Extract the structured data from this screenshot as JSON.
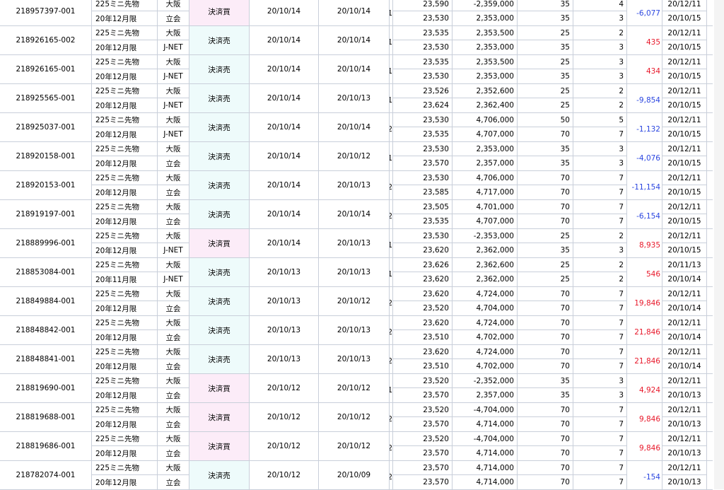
{
  "rows": [
    {
      "id": "218957397-001",
      "product": "225ミニ先物",
      "month": "20年12月限",
      "market1": "大阪",
      "market2": "立会",
      "action": "決済買",
      "date1": "20/10/14",
      "date2": "20/10/14",
      "qty": "1",
      "p1": "23,590",
      "a1": "-2,359,000",
      "f1": "35",
      "t1": "4",
      "p2": "23,530",
      "a2": "2,353,000",
      "f2": "35",
      "t2": "3",
      "pl": "-6,077",
      "sign": "neg",
      "d1": "20/12/11",
      "d2": "20/10/15"
    },
    {
      "id": "218926165-002",
      "product": "225ミニ先物",
      "month": "20年12月限",
      "market1": "大阪",
      "market2": "J-NET",
      "action": "決済売",
      "date1": "20/10/14",
      "date2": "20/10/14",
      "qty": "1",
      "p1": "23,535",
      "a1": "2,353,500",
      "f1": "25",
      "t1": "2",
      "p2": "23,530",
      "a2": "2,353,000",
      "f2": "35",
      "t2": "3",
      "pl": "435",
      "sign": "pos",
      "d1": "20/12/11",
      "d2": "20/10/15"
    },
    {
      "id": "218926165-001",
      "product": "225ミニ先物",
      "month": "20年12月限",
      "market1": "大阪",
      "market2": "J-NET",
      "action": "決済売",
      "date1": "20/10/14",
      "date2": "20/10/14",
      "qty": "1",
      "p1": "23,535",
      "a1": "2,353,500",
      "f1": "25",
      "t1": "3",
      "p2": "23,530",
      "a2": "2,353,000",
      "f2": "35",
      "t2": "3",
      "pl": "434",
      "sign": "pos",
      "d1": "20/12/11",
      "d2": "20/10/15"
    },
    {
      "id": "218925565-001",
      "product": "225ミニ先物",
      "month": "20年12月限",
      "market1": "大阪",
      "market2": "J-NET",
      "action": "決済売",
      "date1": "20/10/14",
      "date2": "20/10/13",
      "qty": "1",
      "p1": "23,526",
      "a1": "2,352,600",
      "f1": "25",
      "t1": "2",
      "p2": "23,624",
      "a2": "2,362,400",
      "f2": "25",
      "t2": "2",
      "pl": "-9,854",
      "sign": "neg",
      "d1": "20/12/11",
      "d2": "20/10/15"
    },
    {
      "id": "218925037-001",
      "product": "225ミニ先物",
      "month": "20年12月限",
      "market1": "大阪",
      "market2": "J-NET",
      "action": "決済売",
      "date1": "20/10/14",
      "date2": "20/10/14",
      "qty": "2",
      "p1": "23,530",
      "a1": "4,706,000",
      "f1": "50",
      "t1": "5",
      "p2": "23,535",
      "a2": "4,707,000",
      "f2": "70",
      "t2": "7",
      "pl": "-1,132",
      "sign": "neg",
      "d1": "20/12/11",
      "d2": "20/10/15"
    },
    {
      "id": "218920158-001",
      "product": "225ミニ先物",
      "month": "20年12月限",
      "market1": "大阪",
      "market2": "立会",
      "action": "決済売",
      "date1": "20/10/14",
      "date2": "20/10/12",
      "qty": "1",
      "p1": "23,530",
      "a1": "2,353,000",
      "f1": "35",
      "t1": "3",
      "p2": "23,570",
      "a2": "2,357,000",
      "f2": "35",
      "t2": "3",
      "pl": "-4,076",
      "sign": "neg",
      "d1": "20/12/11",
      "d2": "20/10/15"
    },
    {
      "id": "218920153-001",
      "product": "225ミニ先物",
      "month": "20年12月限",
      "market1": "大阪",
      "market2": "立会",
      "action": "決済売",
      "date1": "20/10/14",
      "date2": "20/10/13",
      "qty": "2",
      "p1": "23,530",
      "a1": "4,706,000",
      "f1": "70",
      "t1": "7",
      "p2": "23,585",
      "a2": "4,717,000",
      "f2": "70",
      "t2": "7",
      "pl": "-11,154",
      "sign": "neg",
      "d1": "20/12/11",
      "d2": "20/10/15"
    },
    {
      "id": "218919197-001",
      "product": "225ミニ先物",
      "month": "20年12月限",
      "market1": "大阪",
      "market2": "立会",
      "action": "決済売",
      "date1": "20/10/14",
      "date2": "20/10/14",
      "qty": "2",
      "p1": "23,505",
      "a1": "4,701,000",
      "f1": "70",
      "t1": "7",
      "p2": "23,535",
      "a2": "4,707,000",
      "f2": "70",
      "t2": "7",
      "pl": "-6,154",
      "sign": "neg",
      "d1": "20/12/11",
      "d2": "20/10/15"
    },
    {
      "id": "218889996-001",
      "product": "225ミニ先物",
      "month": "20年12月限",
      "market1": "大阪",
      "market2": "J-NET",
      "action": "決済買",
      "date1": "20/10/14",
      "date2": "20/10/13",
      "qty": "1",
      "p1": "23,530",
      "a1": "-2,353,000",
      "f1": "25",
      "t1": "2",
      "p2": "23,620",
      "a2": "2,362,000",
      "f2": "35",
      "t2": "3",
      "pl": "8,935",
      "sign": "pos",
      "d1": "20/12/11",
      "d2": "20/10/15"
    },
    {
      "id": "218853084-001",
      "product": "225ミニ先物",
      "month": "20年11月限",
      "market1": "大阪",
      "market2": "J-NET",
      "action": "決済売",
      "date1": "20/10/13",
      "date2": "20/10/13",
      "qty": "1",
      "p1": "23,626",
      "a1": "2,362,600",
      "f1": "25",
      "t1": "2",
      "p2": "23,620",
      "a2": "2,362,000",
      "f2": "25",
      "t2": "2",
      "pl": "546",
      "sign": "pos",
      "d1": "20/11/13",
      "d2": "20/10/14"
    },
    {
      "id": "218849884-001",
      "product": "225ミニ先物",
      "month": "20年12月限",
      "market1": "大阪",
      "market2": "立会",
      "action": "決済売",
      "date1": "20/10/13",
      "date2": "20/10/12",
      "qty": "2",
      "p1": "23,620",
      "a1": "4,724,000",
      "f1": "70",
      "t1": "7",
      "p2": "23,520",
      "a2": "4,704,000",
      "f2": "70",
      "t2": "7",
      "pl": "19,846",
      "sign": "pos",
      "d1": "20/12/11",
      "d2": "20/10/14"
    },
    {
      "id": "218848842-001",
      "product": "225ミニ先物",
      "month": "20年12月限",
      "market1": "大阪",
      "market2": "立会",
      "action": "決済売",
      "date1": "20/10/13",
      "date2": "20/10/13",
      "qty": "2",
      "p1": "23,620",
      "a1": "4,724,000",
      "f1": "70",
      "t1": "7",
      "p2": "23,510",
      "a2": "4,702,000",
      "f2": "70",
      "t2": "7",
      "pl": "21,846",
      "sign": "pos",
      "d1": "20/12/11",
      "d2": "20/10/14"
    },
    {
      "id": "218848841-001",
      "product": "225ミニ先物",
      "month": "20年12月限",
      "market1": "大阪",
      "market2": "立会",
      "action": "決済売",
      "date1": "20/10/13",
      "date2": "20/10/13",
      "qty": "2",
      "p1": "23,620",
      "a1": "4,724,000",
      "f1": "70",
      "t1": "7",
      "p2": "23,510",
      "a2": "4,702,000",
      "f2": "70",
      "t2": "7",
      "pl": "21,846",
      "sign": "pos",
      "d1": "20/12/11",
      "d2": "20/10/14"
    },
    {
      "id": "218819690-001",
      "product": "225ミニ先物",
      "month": "20年12月限",
      "market1": "大阪",
      "market2": "立会",
      "action": "決済買",
      "date1": "20/10/12",
      "date2": "20/10/12",
      "qty": "1",
      "p1": "23,520",
      "a1": "-2,352,000",
      "f1": "35",
      "t1": "3",
      "p2": "23,570",
      "a2": "2,357,000",
      "f2": "35",
      "t2": "3",
      "pl": "4,924",
      "sign": "pos",
      "d1": "20/12/11",
      "d2": "20/10/13"
    },
    {
      "id": "218819688-001",
      "product": "225ミニ先物",
      "month": "20年12月限",
      "market1": "大阪",
      "market2": "立会",
      "action": "決済買",
      "date1": "20/10/12",
      "date2": "20/10/12",
      "qty": "2",
      "p1": "23,520",
      "a1": "-4,704,000",
      "f1": "70",
      "t1": "7",
      "p2": "23,570",
      "a2": "4,714,000",
      "f2": "70",
      "t2": "7",
      "pl": "9,846",
      "sign": "pos",
      "d1": "20/12/11",
      "d2": "20/10/13"
    },
    {
      "id": "218819686-001",
      "product": "225ミニ先物",
      "month": "20年12月限",
      "market1": "大阪",
      "market2": "立会",
      "action": "決済買",
      "date1": "20/10/12",
      "date2": "20/10/12",
      "qty": "2",
      "p1": "23,520",
      "a1": "-4,704,000",
      "f1": "70",
      "t1": "7",
      "p2": "23,570",
      "a2": "4,714,000",
      "f2": "70",
      "t2": "7",
      "pl": "9,846",
      "sign": "pos",
      "d1": "20/12/11",
      "d2": "20/10/13"
    },
    {
      "id": "218782074-001",
      "product": "225ミニ先物",
      "month": "20年12月限",
      "market1": "大阪",
      "market2": "立会",
      "action": "決済売",
      "date1": "20/10/12",
      "date2": "20/10/09",
      "qty": "2",
      "p1": "23,570",
      "a1": "4,714,000",
      "f1": "70",
      "t1": "7",
      "p2": "23,570",
      "a2": "4,714,000",
      "f2": "70",
      "t2": "7",
      "pl": "-154",
      "sign": "neg",
      "d1": "20/12/11",
      "d2": "20/10/13"
    }
  ],
  "colors": {
    "negative": "#2b46e0",
    "positive": "#e8182a",
    "sell_bg": "#eefbfb",
    "buy_bg": "#fcecf8",
    "grid": "#c9cfda"
  }
}
